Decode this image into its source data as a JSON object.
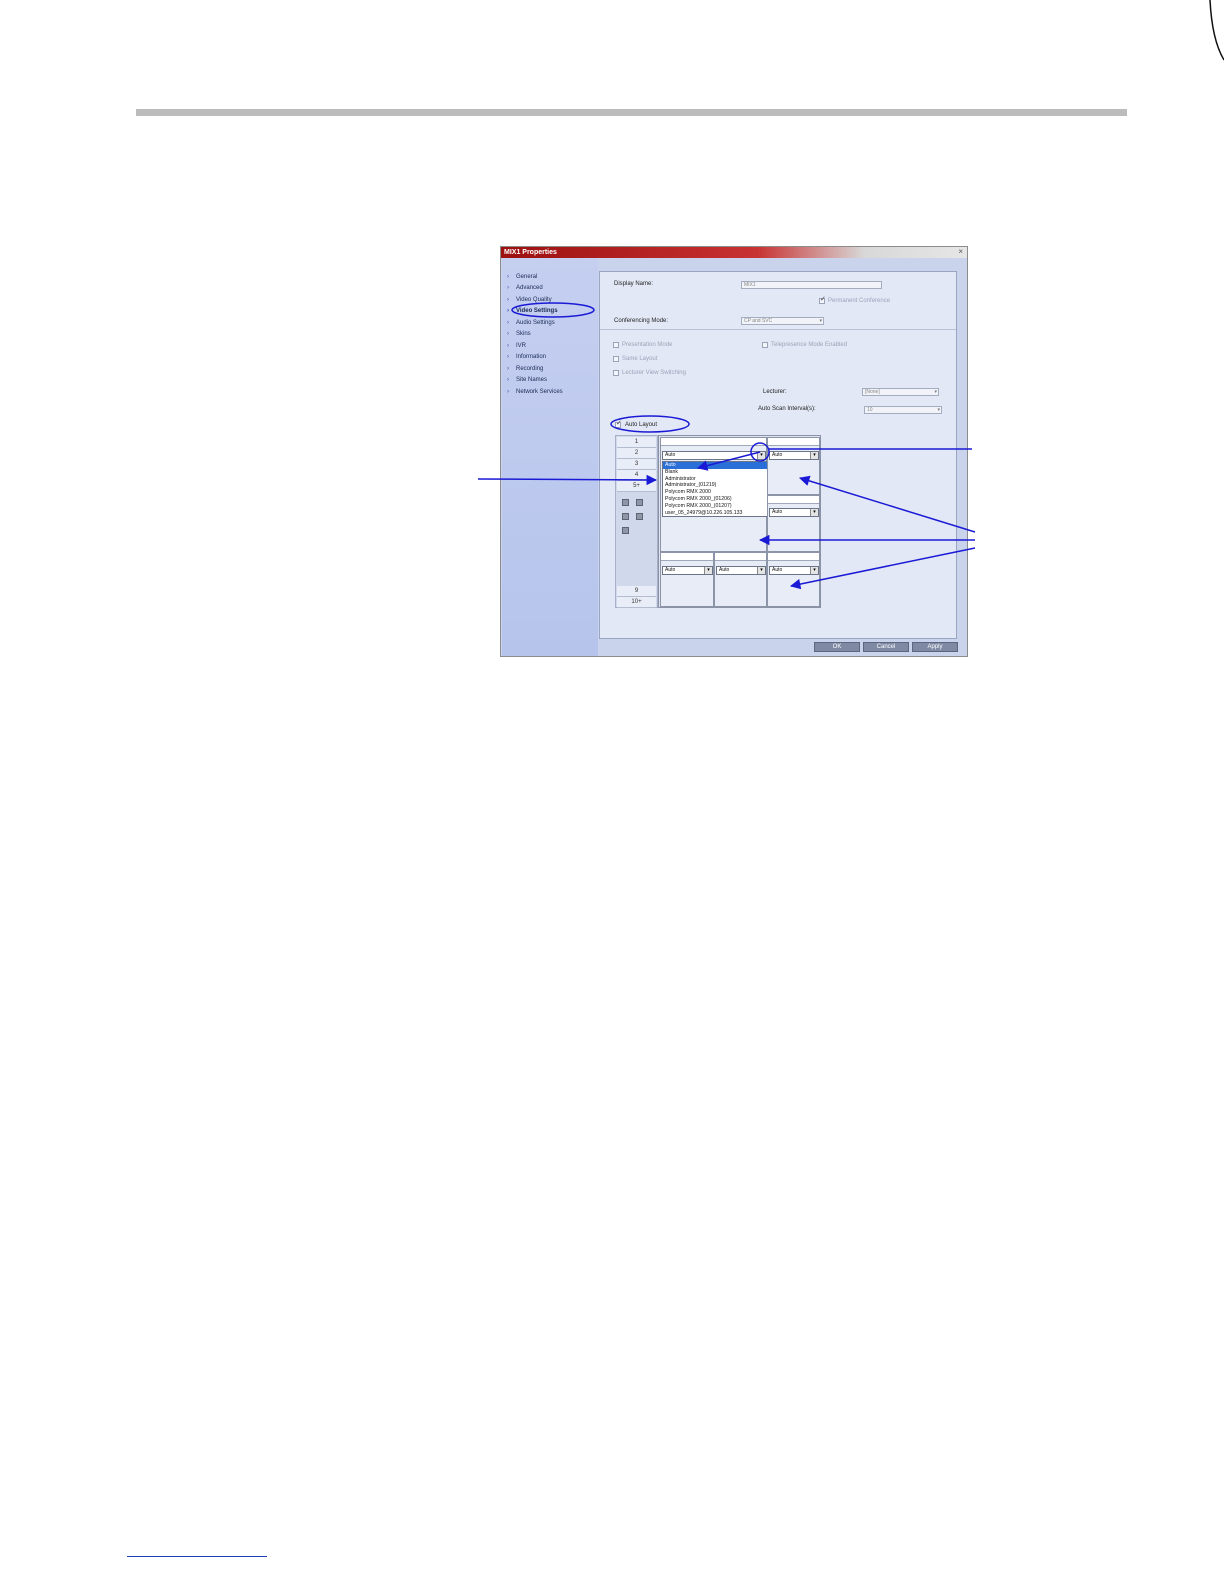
{
  "dialog": {
    "title": "MIX1 Properties",
    "close": "×",
    "nav": [
      "General",
      "Advanced",
      "Video Quality",
      "Video Settings",
      "Audio Settings",
      "Skins",
      "IVR",
      "Information",
      "Recording",
      "Site Names",
      "Network Services"
    ],
    "active_nav": "Video Settings",
    "display_name_label": "Display Name:",
    "display_name_value": "MIX1",
    "permanent_conference": "Permanent Conference",
    "conferencing_mode_label": "Conferencing Mode:",
    "conferencing_mode_value": "CP and SVC",
    "presentation_mode": "Presentation Mode",
    "telepresence_mode": "Telepresence Mode Enabled",
    "same_layout": "Same Layout",
    "lecturer_view_switching": "Lecturer View Switching",
    "lecturer_label": "Lecturer:",
    "lecturer_value": "[None]",
    "auto_scan_label": "Auto Scan Interval(s):",
    "auto_scan_value": "10",
    "auto_layout": "Auto Layout",
    "layout_tabs": [
      "1",
      "2",
      "3",
      "4",
      "5+",
      "9",
      "10+"
    ],
    "cell_select": "Auto",
    "dropdown_options": [
      "Auto",
      "Blank",
      "Administrator",
      "Administrator_(01219)",
      "Polycom RMX 2000",
      "Polycom RMX 2000_(01206)",
      "Polycom RMX 2000_(01207)",
      "user_05_24979@10.226.105.133"
    ],
    "buttons": {
      "ok": "OK",
      "cancel": "Cancel",
      "apply": "Apply"
    }
  },
  "colors": {
    "annotation": "#1a1ad6",
    "titlebar": "#b01818"
  }
}
